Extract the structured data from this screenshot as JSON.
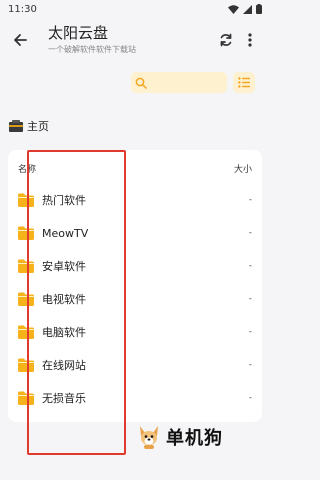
{
  "status_bar": {
    "time": "11:30"
  },
  "header": {
    "title": "太阳云盘",
    "subtitle": "一个破解软件软件下载站"
  },
  "search": {
    "placeholder": "",
    "value": ""
  },
  "breadcrumb": {
    "label": "主页"
  },
  "table": {
    "col_name": "名称",
    "col_size": "大小",
    "rows": [
      {
        "name": "热门软件",
        "size": "-"
      },
      {
        "name": "MeowTV",
        "size": "-"
      },
      {
        "name": "安卓软件",
        "size": "-"
      },
      {
        "name": "电视软件",
        "size": "-"
      },
      {
        "name": "电脑软件",
        "size": "-"
      },
      {
        "name": "在线网站",
        "size": "-"
      },
      {
        "name": "无损音乐",
        "size": "-"
      }
    ]
  },
  "watermark": {
    "text": "单机狗"
  },
  "colors": {
    "accent": "#f5a623",
    "folder": "#f6b21b",
    "highlight": "#e03a2f",
    "search_bg": "#fdf1cf"
  },
  "icons": {
    "back": "arrow-left-icon",
    "refresh": "refresh-icon",
    "more": "more-vertical-icon",
    "search": "search-icon",
    "list_view": "list-view-icon",
    "home": "home-icon",
    "folder": "folder-icon"
  }
}
